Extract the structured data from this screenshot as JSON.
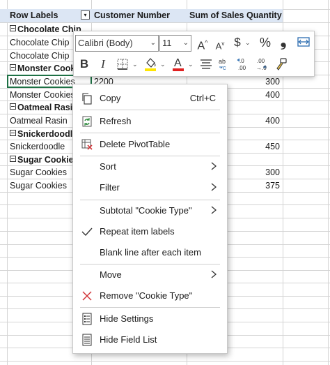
{
  "pivot": {
    "headers": {
      "row_labels": "Row Labels",
      "customer_number": "Customer Number",
      "sum_sales": "Sum of Sales Quantity"
    },
    "rows": [
      {
        "label": "Chocolate Chip",
        "group": true,
        "customer": "",
        "qty": ""
      },
      {
        "label": "Chocolate Chip",
        "group": false,
        "customer": "",
        "qty": ""
      },
      {
        "label": "Chocolate Chip",
        "group": false,
        "customer": "",
        "qty": ""
      },
      {
        "label": "Monster Cookie",
        "group": true,
        "customer": "",
        "qty": ""
      },
      {
        "label": "Monster Cookies",
        "group": false,
        "customer": "2200",
        "qty": "300"
      },
      {
        "label": "Monster Cookies",
        "group": false,
        "customer": "",
        "qty": "400"
      },
      {
        "label": "Oatmeal Rasin",
        "group": true,
        "customer": "",
        "qty": ""
      },
      {
        "label": "Oatmeal Rasin",
        "group": false,
        "customer": "",
        "qty": "400"
      },
      {
        "label": "Snickerdoodle",
        "group": true,
        "customer": "",
        "qty": ""
      },
      {
        "label": "Snickerdoodle",
        "group": false,
        "customer": "",
        "qty": "450"
      },
      {
        "label": "Sugar Cookies",
        "group": true,
        "customer": "",
        "qty": ""
      },
      {
        "label": "Sugar Cookies",
        "group": false,
        "customer": "",
        "qty": "300"
      },
      {
        "label": "Sugar Cookies",
        "group": false,
        "customer": "",
        "qty": "375"
      }
    ]
  },
  "toolbar": {
    "font_name": "Calibri (Body)",
    "font_size": "11",
    "increase_font": "A",
    "decrease_font": "A",
    "currency": "$",
    "percent": "%",
    "comma": "❟",
    "bold": "B",
    "italic": "I",
    "font_color_letter": "A"
  },
  "menu": {
    "copy": "Copy",
    "copy_shortcut": "Ctrl+C",
    "refresh": "Refresh",
    "delete_pivot": "Delete PivotTable",
    "sort": "Sort",
    "filter": "Filter",
    "subtotal": "Subtotal \"Cookie Type\"",
    "repeat_labels": "Repeat item labels",
    "blank_line": "Blank line after each item",
    "move": "Move",
    "remove": "Remove \"Cookie Type\"",
    "hide_settings": "Hide Settings",
    "hide_field_list": "Hide Field List"
  },
  "colors": {
    "header_bg": "#dce6f4",
    "selection": "#1e7145",
    "remove_x": "#d13438",
    "refresh_green": "#2e8b3d",
    "font_color_red": "#e02020",
    "fill_yellow": "#ffe600"
  }
}
